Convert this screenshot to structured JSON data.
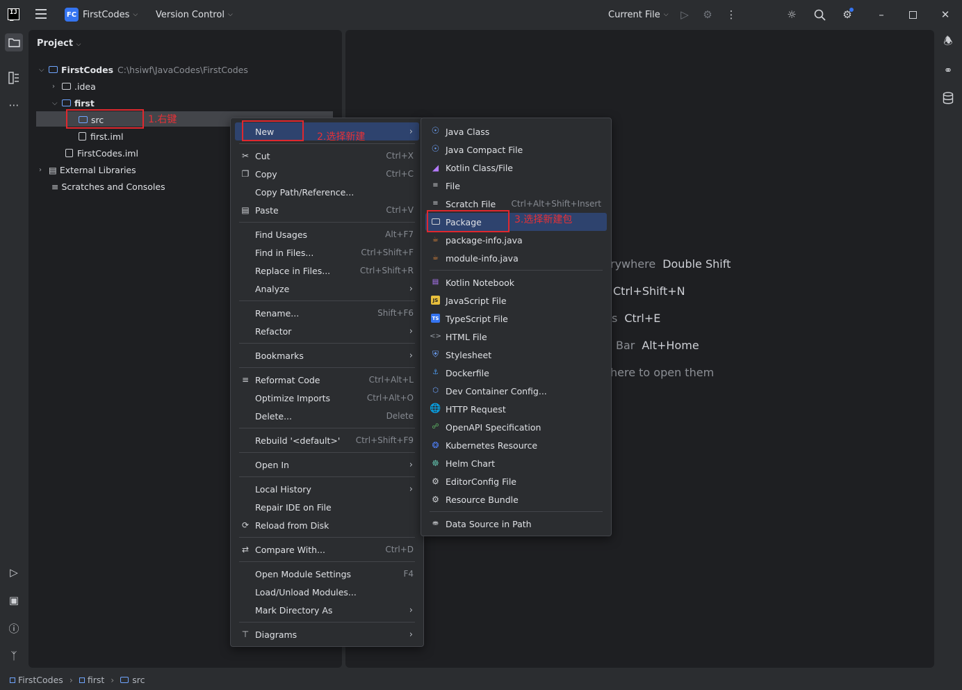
{
  "titlebar": {
    "project_badge": "FC",
    "project_name": "FirstCodes",
    "vcs": "Version Control",
    "run_config": "Current File"
  },
  "project_panel": {
    "title": "Project",
    "tree": [
      {
        "label": "FirstCodes",
        "path": "C:\\hsiwf\\JavaCodes\\FirstCodes"
      },
      {
        "label": ".idea"
      },
      {
        "label": "first"
      },
      {
        "label": "src"
      },
      {
        "label": "first.iml"
      },
      {
        "label": "FirstCodes.iml"
      },
      {
        "label": "External Libraries"
      },
      {
        "label": "Scratches and Consoles"
      }
    ]
  },
  "annotations": {
    "step1": "1.右键",
    "step2": "2.选择新建",
    "step3": "3.选择新建包"
  },
  "editor_hints": [
    {
      "text": "rywhere",
      "key": "Double Shift"
    },
    {
      "text": "",
      "key": "Ctrl+Shift+N"
    },
    {
      "text": "s",
      "key": "Ctrl+E"
    },
    {
      "text": "Bar",
      "key": "Alt+Home"
    },
    {
      "text": "here to open them",
      "key": ""
    }
  ],
  "context_menu": [
    {
      "label": "New",
      "shortcut": "",
      "submenu": true
    },
    {
      "label": "Cut",
      "shortcut": "Ctrl+X"
    },
    {
      "label": "Copy",
      "shortcut": "Ctrl+C"
    },
    {
      "label": "Copy Path/Reference...",
      "shortcut": ""
    },
    {
      "label": "Paste",
      "shortcut": "Ctrl+V"
    },
    {
      "label": "Find Usages",
      "shortcut": "Alt+F7"
    },
    {
      "label": "Find in Files...",
      "shortcut": "Ctrl+Shift+F"
    },
    {
      "label": "Replace in Files...",
      "shortcut": "Ctrl+Shift+R"
    },
    {
      "label": "Analyze",
      "shortcut": "",
      "submenu": true
    },
    {
      "label": "Rename...",
      "shortcut": "Shift+F6"
    },
    {
      "label": "Refactor",
      "shortcut": "",
      "submenu": true
    },
    {
      "label": "Bookmarks",
      "shortcut": "",
      "submenu": true
    },
    {
      "label": "Reformat Code",
      "shortcut": "Ctrl+Alt+L"
    },
    {
      "label": "Optimize Imports",
      "shortcut": "Ctrl+Alt+O"
    },
    {
      "label": "Delete...",
      "shortcut": "Delete"
    },
    {
      "label": "Rebuild '<default>'",
      "shortcut": "Ctrl+Shift+F9"
    },
    {
      "label": "Open In",
      "shortcut": "",
      "submenu": true
    },
    {
      "label": "Local History",
      "shortcut": "",
      "submenu": true
    },
    {
      "label": "Repair IDE on File",
      "shortcut": ""
    },
    {
      "label": "Reload from Disk",
      "shortcut": ""
    },
    {
      "label": "Compare With...",
      "shortcut": "Ctrl+D"
    },
    {
      "label": "Open Module Settings",
      "shortcut": "F4"
    },
    {
      "label": "Load/Unload Modules...",
      "shortcut": ""
    },
    {
      "label": "Mark Directory As",
      "shortcut": "",
      "submenu": true
    },
    {
      "label": "Diagrams",
      "shortcut": "",
      "submenu": true
    }
  ],
  "new_submenu": [
    {
      "label": "Java Class",
      "shortcut": ""
    },
    {
      "label": "Java Compact File",
      "shortcut": ""
    },
    {
      "label": "Kotlin Class/File",
      "shortcut": ""
    },
    {
      "label": "File",
      "shortcut": ""
    },
    {
      "label": "Scratch File",
      "shortcut": "Ctrl+Alt+Shift+Insert"
    },
    {
      "label": "Package",
      "shortcut": ""
    },
    {
      "label": "package-info.java",
      "shortcut": ""
    },
    {
      "label": "module-info.java",
      "shortcut": ""
    },
    {
      "label": "Kotlin Notebook",
      "shortcut": ""
    },
    {
      "label": "JavaScript File",
      "shortcut": ""
    },
    {
      "label": "TypeScript File",
      "shortcut": ""
    },
    {
      "label": "HTML File",
      "shortcut": ""
    },
    {
      "label": "Stylesheet",
      "shortcut": ""
    },
    {
      "label": "Dockerfile",
      "shortcut": ""
    },
    {
      "label": "Dev Container Config...",
      "shortcut": ""
    },
    {
      "label": "HTTP Request",
      "shortcut": ""
    },
    {
      "label": "OpenAPI Specification",
      "shortcut": ""
    },
    {
      "label": "Kubernetes Resource",
      "shortcut": ""
    },
    {
      "label": "Helm Chart",
      "shortcut": ""
    },
    {
      "label": "EditorConfig File",
      "shortcut": ""
    },
    {
      "label": "Resource Bundle",
      "shortcut": ""
    },
    {
      "label": "Data Source in Path",
      "shortcut": ""
    }
  ],
  "badges": {
    "js": "JS",
    "ts": "TS"
  },
  "statusbar": {
    "crumbs": [
      "FirstCodes",
      "first",
      "src"
    ]
  }
}
